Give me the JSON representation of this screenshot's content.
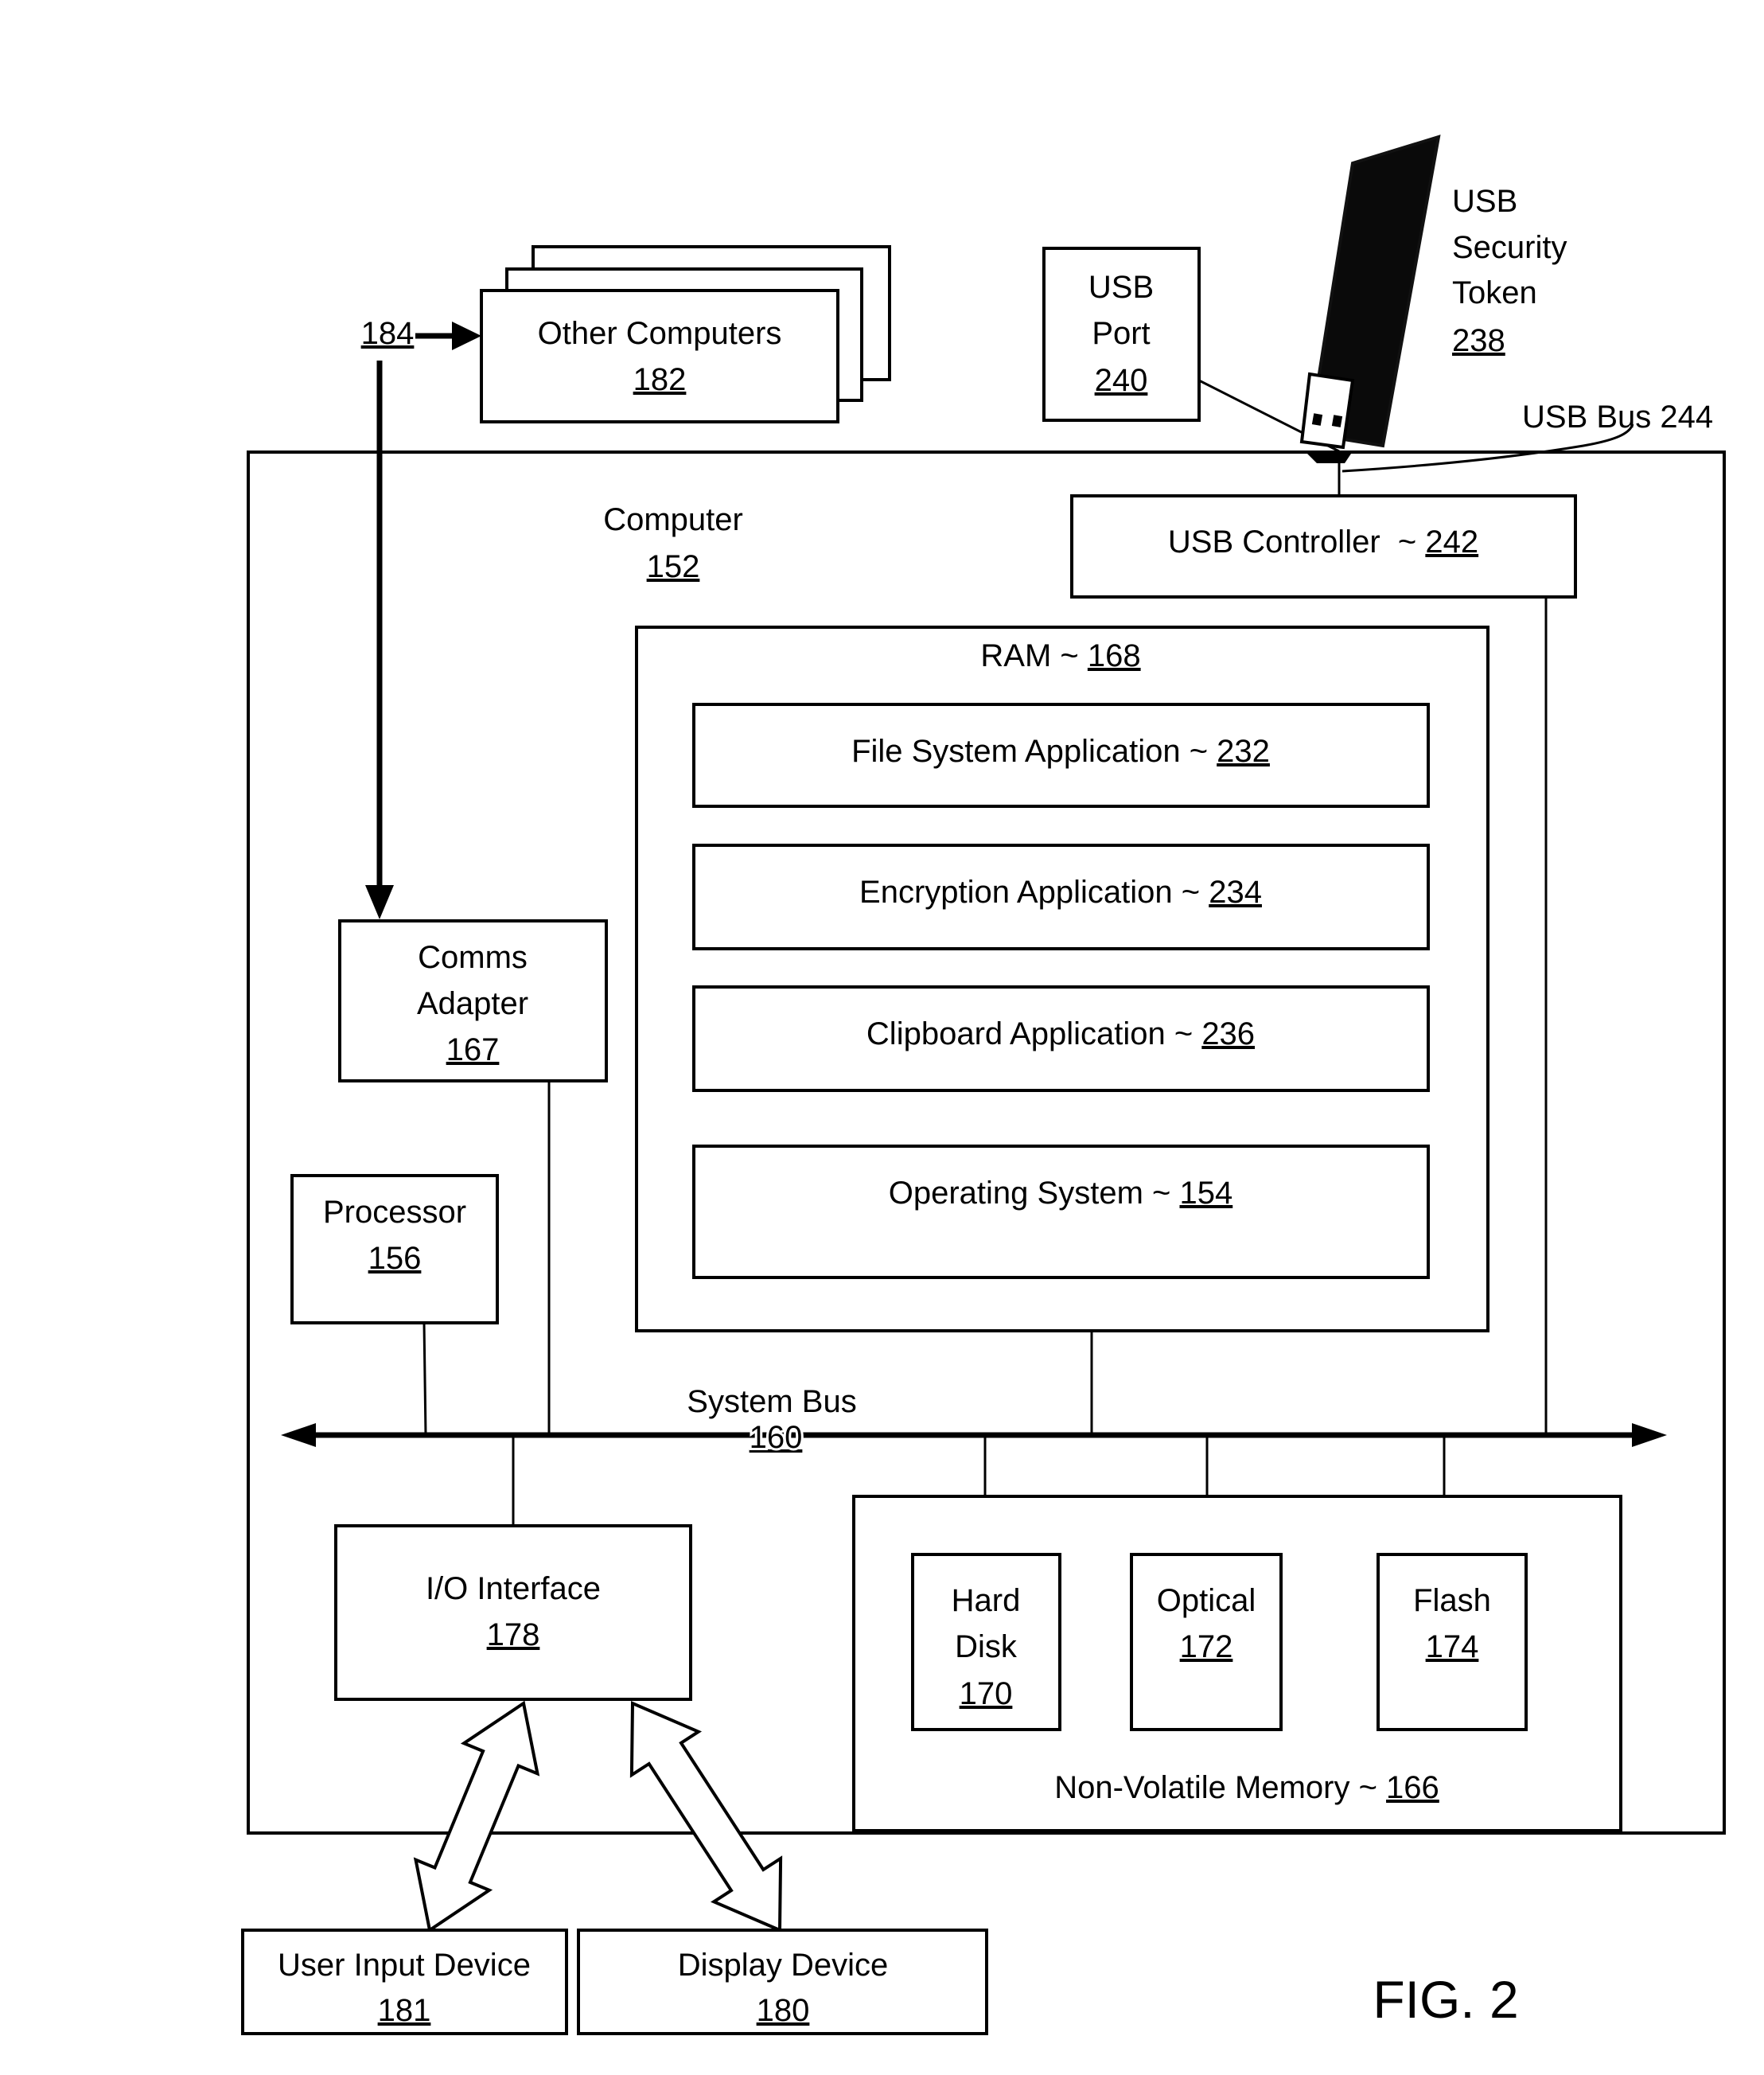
{
  "figure": {
    "label": "FIG. 2",
    "ink_color": "#000000",
    "background_color": "#ffffff"
  },
  "other_computers": {
    "label": "Other Computers",
    "ref": "182"
  },
  "network_link": {
    "ref": "184"
  },
  "usb_port": {
    "line1": "USB",
    "line2": "Port",
    "ref": "240"
  },
  "usb_token": {
    "line1": "USB",
    "line2": "Security",
    "line3": "Token",
    "ref": "238"
  },
  "usb_bus": {
    "label": "USB Bus 244"
  },
  "computer": {
    "label": "Computer",
    "ref": "152"
  },
  "usb_controller": {
    "label": "USB Controller  ~ ",
    "ref": "242"
  },
  "ram": {
    "label": "RAM ~ ",
    "ref": "168",
    "apps": [
      {
        "label": "File System Application ~ ",
        "ref": "232"
      },
      {
        "label": "Encryption Application ~ ",
        "ref": "234"
      },
      {
        "label": "Clipboard Application ~ ",
        "ref": "236"
      },
      {
        "label": "Operating System ~ ",
        "ref": "154"
      }
    ]
  },
  "comms_adapter": {
    "line1": "Comms",
    "line2": "Adapter",
    "ref": "167"
  },
  "processor": {
    "label": "Processor",
    "ref": "156"
  },
  "system_bus": {
    "label": "System Bus",
    "ref": "160"
  },
  "io_interface": {
    "label": "I/O Interface",
    "ref": "178"
  },
  "non_volatile_memory": {
    "label": "Non-Volatile Memory ~ ",
    "ref": "166",
    "hard_disk": {
      "line1": "Hard",
      "line2": "Disk",
      "ref": "170"
    },
    "optical": {
      "label": "Optical",
      "ref": "172"
    },
    "flash": {
      "label": "Flash",
      "ref": "174"
    }
  },
  "user_input_device": {
    "label": "User Input Device",
    "ref": "181"
  },
  "display_device": {
    "label": "Display Device",
    "ref": "180"
  }
}
